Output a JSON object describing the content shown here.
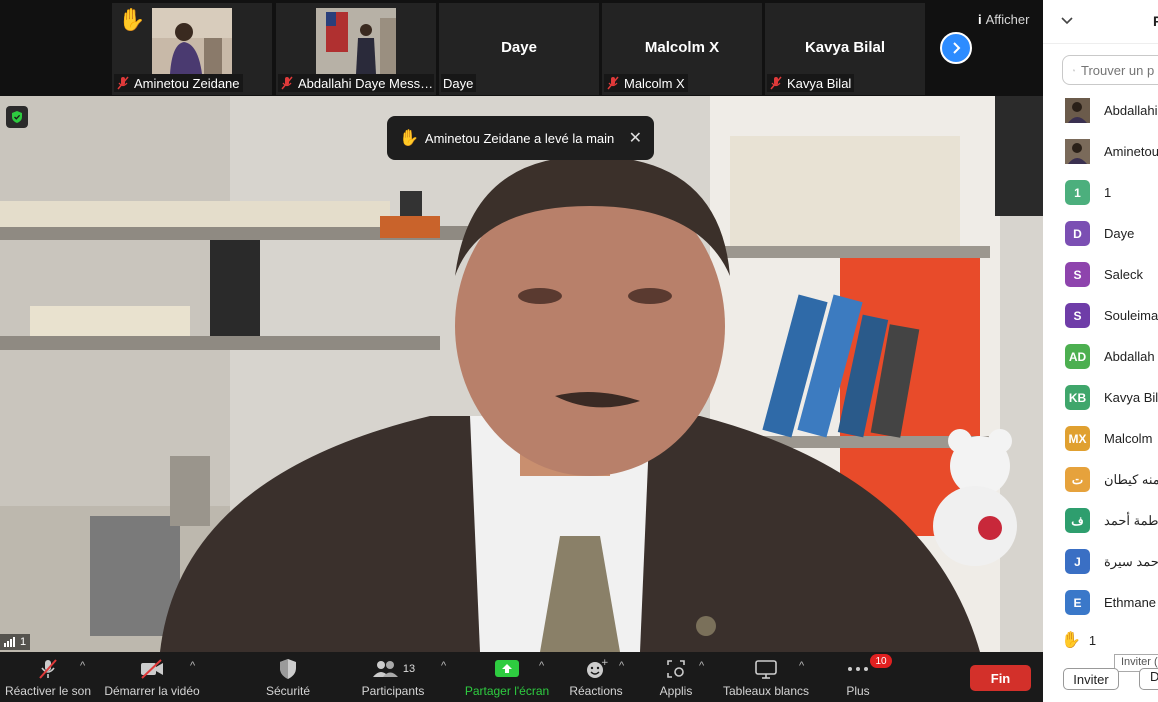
{
  "top_strip": {
    "thumbnails": [
      {
        "label": "Aminetou Zeidane",
        "hand": "✋",
        "muted": true
      },
      {
        "label": "Abdallahi Daye Mess…",
        "muted": true
      },
      {
        "label": "Daye",
        "big": "Daye",
        "muted": false
      },
      {
        "label": "Malcolm X",
        "big": "Malcolm X",
        "muted": true
      },
      {
        "label": "Kavya Bilal",
        "big": "Kavya Bilal",
        "muted": true
      }
    ],
    "show_label": "Afficher"
  },
  "main": {
    "toast": "Aminetou Zeidane a levé la main",
    "signal_count": "1"
  },
  "toolbar": {
    "unmute": "Réactiver le son",
    "start_video": "Démarrer la vidéo",
    "security": "Sécurité",
    "participants": "Participants",
    "participants_count": "13",
    "share": "Partager l'écran",
    "reactions": "Réactions",
    "apps": "Applis",
    "whiteboards": "Tableaux blancs",
    "more": "Plus",
    "more_badge": "10",
    "end": "Fin"
  },
  "panel": {
    "title": "P",
    "search_placeholder": "Trouver un p",
    "participants": [
      {
        "name": "Abdallahi",
        "initials": "",
        "color": "#6b5b4b",
        "photo": true
      },
      {
        "name": "Aminetou",
        "initials": "",
        "color": "#7a6a5a",
        "photo": true
      },
      {
        "name": "1",
        "initials": "1",
        "color": "#4caf7d"
      },
      {
        "name": "Daye",
        "initials": "D",
        "color": "#7b4fb3"
      },
      {
        "name": "Saleck",
        "initials": "S",
        "color": "#8e44ad"
      },
      {
        "name": "Souleima",
        "initials": "S",
        "color": "#6f3da8"
      },
      {
        "name": "Abdallah",
        "initials": "AD",
        "color": "#4caf50"
      },
      {
        "name": "Kavya Bila",
        "initials": "KB",
        "color": "#3fa66b"
      },
      {
        "name": "Malcolm",
        "initials": "MX",
        "color": "#e0a030"
      },
      {
        "name": "منه كيطان",
        "initials": "ت",
        "color": "#e6a23c"
      },
      {
        "name": "طمة أحمد",
        "initials": "ف",
        "color": "#2e9e6e"
      },
      {
        "name": "حمد سيرة",
        "initials": "J",
        "color": "#3a6fc4"
      },
      {
        "name": "Ethmane",
        "initials": "E",
        "color": "#3a78c9"
      }
    ],
    "raised_count": "1",
    "tooltip": "Inviter (",
    "invite": "Inviter",
    "more_btn": "D"
  }
}
